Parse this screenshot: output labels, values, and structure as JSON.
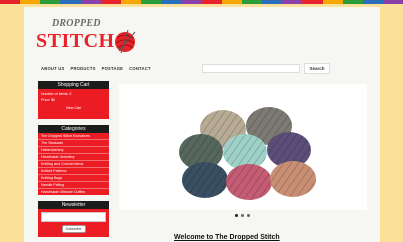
{
  "stripe_colors": [
    "#e8222a",
    "#f7a800",
    "#2a9d3a",
    "#2a6ebb",
    "#8b3fa8",
    "#e8222a",
    "#f7a800",
    "#2a9d3a",
    "#2a6ebb",
    "#8b3fa8",
    "#e8222a",
    "#f7a800",
    "#2a9d3a",
    "#2a6ebb",
    "#8b3fa8",
    "#e8222a",
    "#f7a800",
    "#2a9d3a",
    "#2a6ebb",
    "#8b3fa8"
  ],
  "logo": {
    "line1": "DROPPED",
    "line2": "STITCH"
  },
  "nav": {
    "about": "ABOUT US",
    "products": "PRODUCTS",
    "postage": "POSTAGE",
    "contact": "CONTACT"
  },
  "search": {
    "placeholder": "",
    "button": "Search"
  },
  "cart": {
    "title": "Shopping Cart",
    "items": "Number of items: 0",
    "price": "Price: $0",
    "view": "View Cart"
  },
  "categories": {
    "title": "Categories",
    "items": [
      "The Dropped Stitch Exclusives",
      "The Stockade",
      "Haberdashery",
      "Handmade Jewellery",
      "Knitting and Crochet Items",
      "Knitted Patterns",
      "Knitting Bags",
      "Needle Felting",
      "Handmade Giftware Cuffles"
    ]
  },
  "newsletter": {
    "title": "Newsletter",
    "subscribe": "Subscribe"
  },
  "carousel": {
    "dots": 3,
    "active": 0
  },
  "welcome": "Welcome to The Dropped Stitch"
}
